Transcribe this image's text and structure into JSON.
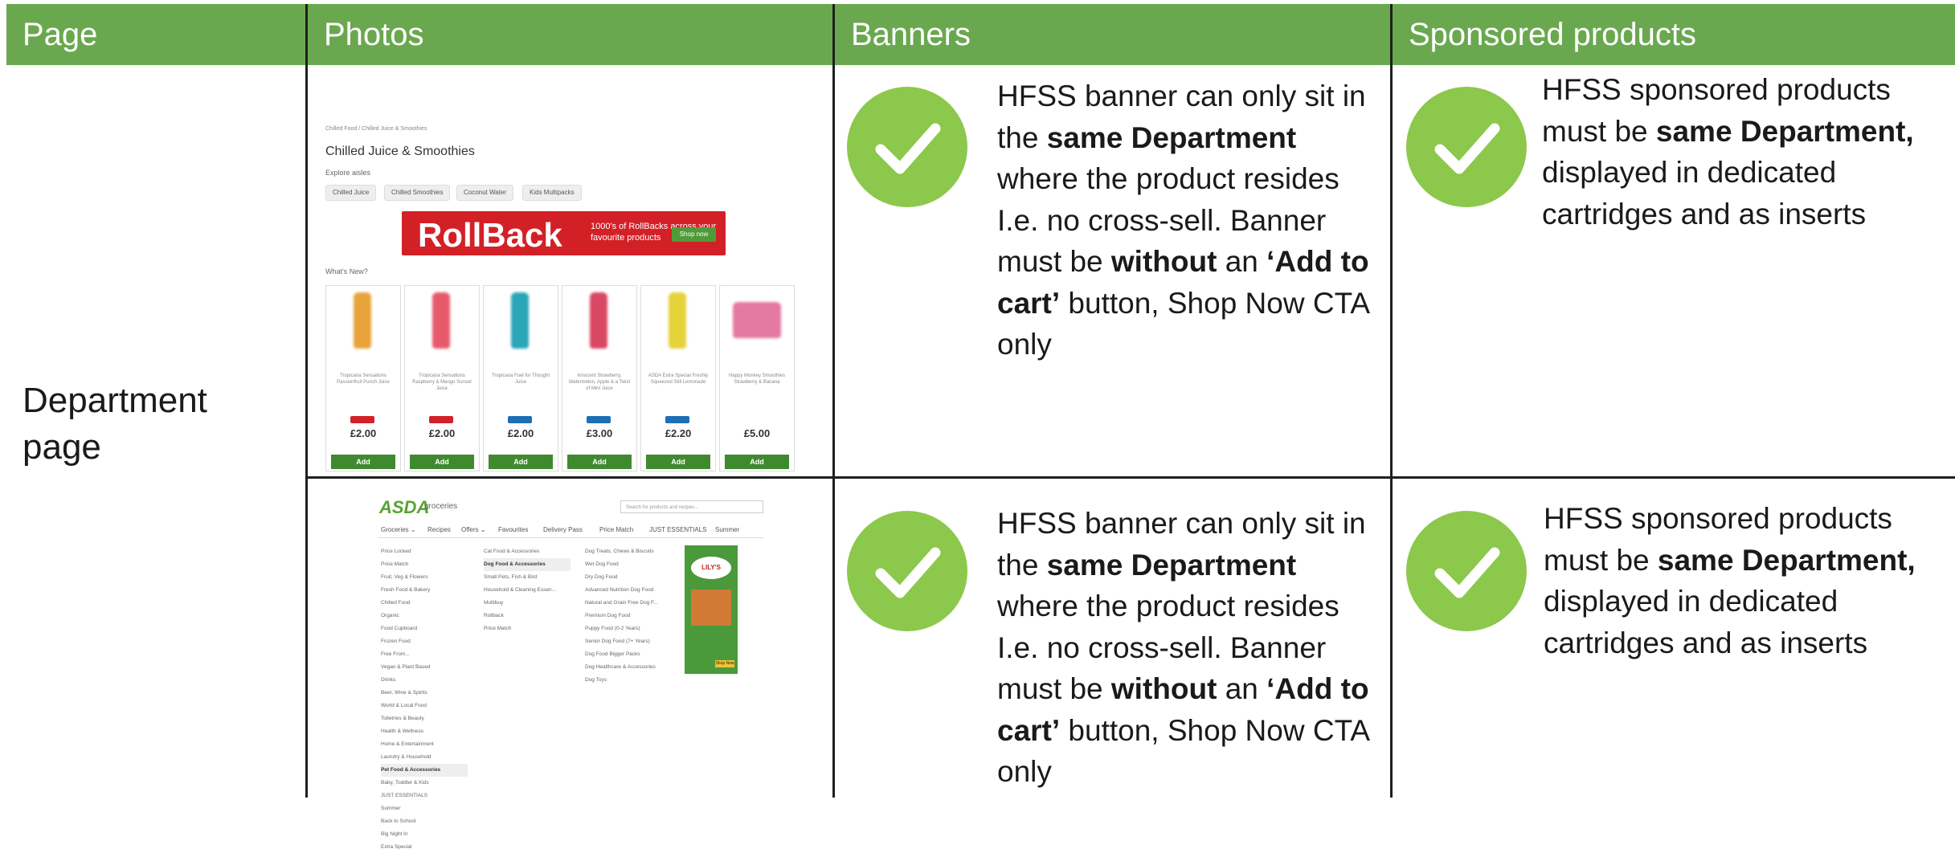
{
  "header": {
    "page": "Page",
    "photos": "Photos",
    "banners": "Banners",
    "sponsored": "Sponsored products"
  },
  "row_label": "Department page",
  "rows": [
    {
      "banner_text": {
        "p1": "HFSS banner can only sit in the ",
        "b1": "same Department",
        "p2": " where the product resides I.e. no cross-sell. Banner must be ",
        "b2": "without",
        "p3": " an ",
        "b3": "‘Add to cart’",
        "p4": " button, Shop Now CTA only"
      },
      "sponsored_text": {
        "p1": "HFSS sponsored products must be ",
        "b1": "same Department,",
        "p2": " displayed in dedicated cartridges and as inserts"
      }
    },
    {
      "banner_text": {
        "p1": "HFSS banner can only sit in the ",
        "b1": "same Department",
        "p2": " where the product resides I.e. no cross-sell. Banner must be ",
        "b2": "without",
        "p3": " an ",
        "b3": "‘Add to cart’",
        "p4": " button, Shop Now CTA only"
      },
      "sponsored_text": {
        "p1": "HFSS sponsored products must be ",
        "b1": "same Department,",
        "p2": " displayed in dedicated cartridges and as inserts"
      }
    }
  ],
  "photo1": {
    "breadcrumb": "Chilled Food / Chilled Juice & Smoothies",
    "title": "Chilled Juice & Smoothies",
    "explore": "Explore aisles",
    "chips": [
      "Chilled Juice",
      "Chilled Smoothies",
      "Coconut Water",
      "Kids Multipacks"
    ],
    "rollback_big": "RollBack",
    "rollback_small": "1000's of RollBacks across your favourite products",
    "rollback_btn": "Shop now",
    "whats_new": "What's New?",
    "products": [
      {
        "desc": "Tropicana Sensations Passionfruit Punch Juice",
        "price": "£2.00",
        "add": "Add",
        "bottle_color": "#e8a43a",
        "badge_color": "#d32027"
      },
      {
        "desc": "Tropicana Sensations Raspberry & Mango Sunset Juice",
        "price": "£2.00",
        "add": "Add",
        "bottle_color": "#e85a6a",
        "badge_color": "#d32027"
      },
      {
        "desc": "Tropicana Fuel for Thought Juice",
        "price": "£2.00",
        "add": "Add",
        "bottle_color": "#2aa6b8",
        "badge_color": "#1d6fb5"
      },
      {
        "desc": "Innocent Strawberry, Watermelon, Apple & a Twist of Mint Juice",
        "price": "£3.00",
        "add": "Add",
        "bottle_color": "#d94862",
        "badge_color": "#1d6fb5"
      },
      {
        "desc": "ASDA Extra Special Freshly Squeezed Still Lemonade",
        "price": "£2.20",
        "add": "Add",
        "bottle_color": "#e6d23a",
        "badge_color": "#1d6fb5"
      },
      {
        "desc": "Happy Monkey Smoothies Strawberry & Banana",
        "price": "£5.00",
        "add": "Add",
        "bottle_color": "#e57aa0",
        "badge_color": "#ffffff"
      }
    ]
  },
  "photo2": {
    "logo": "ASDA",
    "logo_sub": "groceries",
    "search_placeholder": "Search for products and recipes...",
    "nav": [
      "Groceries ⌄",
      "Recipes",
      "Offers ⌄",
      "Favourites",
      "Delivery Pass",
      "Price Match",
      "JUST ESSENTIALS",
      "Summer"
    ],
    "col1": [
      "Price Locked",
      "Price Match",
      "Fruit, Veg & Flowers",
      "Fresh Food & Bakery",
      "Chilled Food",
      "Organic",
      "Food Cupboard",
      "Frozen Food",
      "Free From...",
      "Vegan & Plant Based",
      "Drinks",
      "Beer, Wine & Spirits",
      "World & Local Food",
      "Toiletries & Beauty",
      "Health & Wellness",
      "Home & Entertainment",
      "Laundry & Household",
      "Pet Food & Accessories",
      "Baby, Toddler & Kids",
      "JUST ESSENTIALS",
      "Summer",
      "Back to School",
      "Big Night In",
      "Extra Special"
    ],
    "col2": [
      "Cat Food & Accessories",
      "Dog Food & Accessories",
      "Small Pets, Fish & Bird",
      "Household & Cleaning Essen...",
      "Multibuy",
      "Rollback",
      "Price Match"
    ],
    "col3": [
      "Dog Treats, Chews & Biscuits",
      "Wet Dog Food",
      "Dry Dog Food",
      "Advanced Nutrition Dog Food",
      "Natural and Grain Free Dog F...",
      "Premium Dog Food",
      "Puppy Food (0-2 Years)",
      "Senior Dog Food (7+ Years)",
      "Dog Food Bigger Packs",
      "Dog Healthcare & Accessories",
      "Dog Toys"
    ],
    "banner_brand": "LILY'S",
    "banner_btn": "Shop Now"
  },
  "colors": {
    "header_bg": "#6aa84f",
    "check_bg": "#8cc84b"
  },
  "icons": [
    "check-circle-icon"
  ]
}
